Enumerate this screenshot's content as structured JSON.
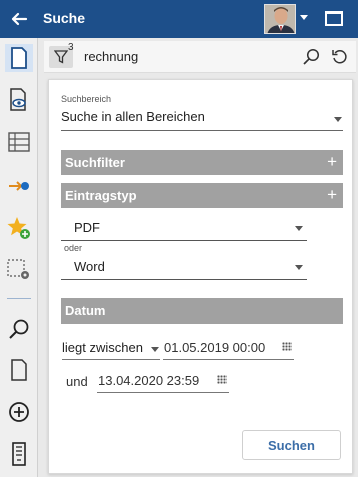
{
  "header": {
    "title": "Suche"
  },
  "searchbar": {
    "filter_count": "3",
    "query": "rechnung"
  },
  "form": {
    "scope": {
      "label": "Suchbereich",
      "value": "Suche in allen Bereichen"
    },
    "sections": {
      "filter": "Suchfilter",
      "entry_type": "Eintragstyp",
      "date": "Datum"
    },
    "entry_types": {
      "first": "PDF",
      "or_label": "oder",
      "second": "Word"
    },
    "date_filter": {
      "operator": "liegt zwischen",
      "from": "01.05.2019 00:00",
      "and_label": "und",
      "to": "13.04.2020 23:59"
    },
    "submit_label": "Suchen"
  },
  "colors": {
    "header_bg": "#1d4f8a",
    "section_bg": "#a1a1a1",
    "accent": "#3c6ea8",
    "rail_active": "#d5e3f4"
  }
}
